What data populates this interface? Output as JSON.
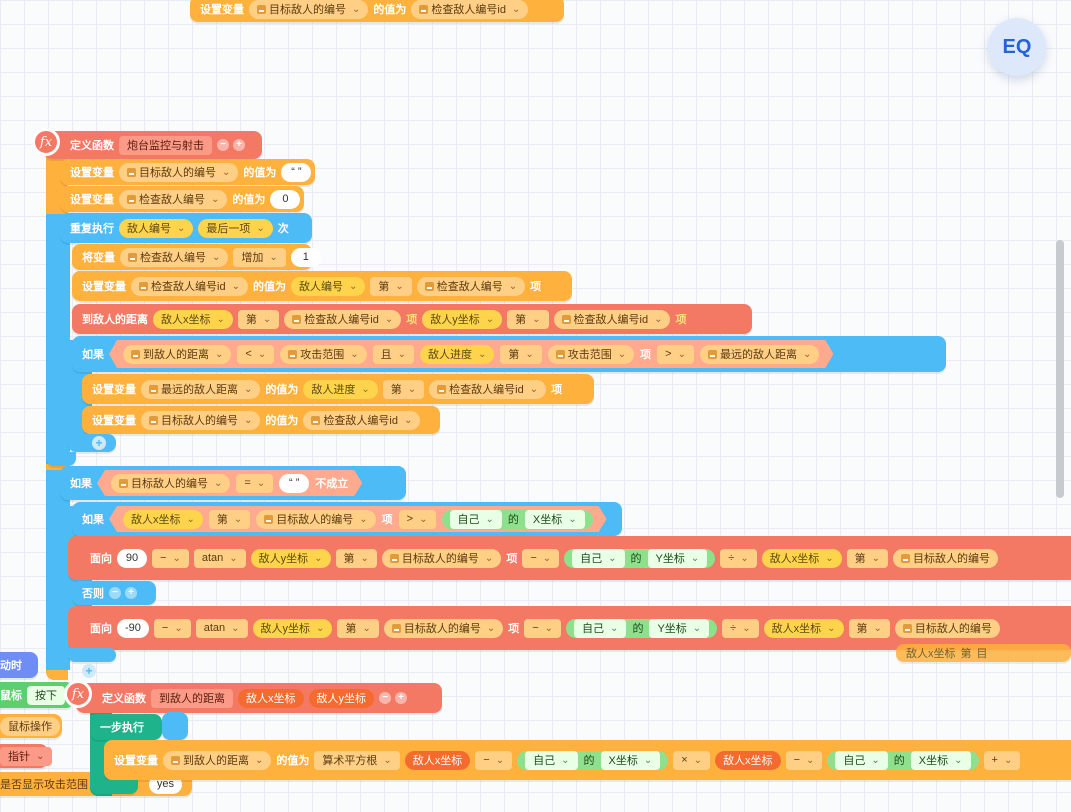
{
  "top_block": {
    "label": "设置变量",
    "var": "目标敌人的编号",
    "mid": "的值为",
    "value": "检查敌人编号id"
  },
  "func1": {
    "define_label": "定义函数",
    "name": "炮台监控与射击",
    "set1": {
      "label": "设置变量",
      "var": "目标敌人的编号",
      "mid": "的值为",
      "value": "“ ”"
    },
    "set2": {
      "label": "设置变量",
      "var": "检查敌人编号",
      "mid": "的值为",
      "value": "0"
    },
    "repeat": {
      "label": "重复执行",
      "list": "敌人编号",
      "item": "最后一项",
      "suffix": "次"
    },
    "inc": {
      "label": "将变量",
      "var": "检查敌人编号",
      "op": "增加",
      "value": "1"
    },
    "set3": {
      "label": "设置变量",
      "var": "检查敌人编号id",
      "mid": "的值为",
      "list": "敌人编号",
      "di": "第",
      "index": "检查敌人编号",
      "xiang": "项"
    },
    "dist": {
      "label": "到敌人的距离",
      "a_list": "敌人x坐标",
      "di": "第",
      "a_index": "检查敌人编号id",
      "xiang": "项",
      "b_list": "敌人y坐标",
      "b_index": "检查敌人编号id"
    },
    "if1": {
      "label": "如果",
      "left": "到敌人的距离",
      "lt": "<",
      "range": "攻击范围",
      "and": "且",
      "progress": "敌人进度",
      "di": "第",
      "idx": "攻击范围",
      "xiang": "项",
      "gt": ">",
      "far": "最远的敌人距离"
    },
    "set4": {
      "label": "设置变量",
      "var": "最远的敌人距离",
      "mid": "的值为",
      "list": "敌人进度",
      "di": "第",
      "index": "检查敌人编号id",
      "xiang": "项"
    },
    "set5": {
      "label": "设置变量",
      "var": "目标敌人的编号",
      "mid": "的值为",
      "value": "检查敌人编号id"
    },
    "if2": {
      "label": "如果",
      "var": "目标敌人的编号",
      "eq": "=",
      "value": "“ ”",
      "not": "不成立"
    },
    "if3": {
      "label": "如果",
      "list": "敌人x坐标",
      "di": "第",
      "index": "目标敌人的编号",
      "xiang": "项",
      "gt": ">",
      "self": "自己",
      "de": "的",
      "prop": "X坐标"
    },
    "face1": {
      "label": "面向",
      "num": "90",
      "minus": "−",
      "fn": "atan",
      "list": "敌人y坐标",
      "di": "第",
      "index": "目标敌人的编号",
      "xiang": "项",
      "self": "自己",
      "de": "的",
      "prop": "Y坐标",
      "div": "÷",
      "list2": "敌人x坐标",
      "index2": "目标敌人的编号"
    },
    "else": "否则",
    "face2": {
      "label": "面向",
      "num": "-90",
      "minus": "−",
      "fn": "atan",
      "list": "敌人y坐标",
      "di": "第",
      "index": "目标敌人的编号",
      "xiang": "项",
      "self": "自己",
      "de": "的",
      "prop": "Y坐标",
      "div": "÷",
      "list2": "敌人x坐标",
      "index2": "目标敌人的编号"
    },
    "behind_x": "敌人x坐标",
    "behind_di": "第",
    "behind_cut": "目"
  },
  "func2": {
    "define_label": "定义函数",
    "name": "到敌人的距离",
    "param1": "敌人x坐标",
    "param2": "敌人y坐标",
    "step": "一步执行",
    "set": {
      "label": "设置变量",
      "var": "到敌人的距离",
      "mid": "的值为",
      "fn": "算术平方根",
      "p": "敌人x坐标",
      "minus": "−",
      "self": "自己",
      "de": "的",
      "prop": "X坐标",
      "times": "×",
      "plus": "+"
    }
  },
  "left_fragments": {
    "event": "动时",
    "mouse": "鼠标",
    "press": "按下",
    "mouse_op": "鼠标操作",
    "clock": "指针",
    "show": "是否显示攻击范围",
    "yes": "yes"
  },
  "logo": "EQ"
}
